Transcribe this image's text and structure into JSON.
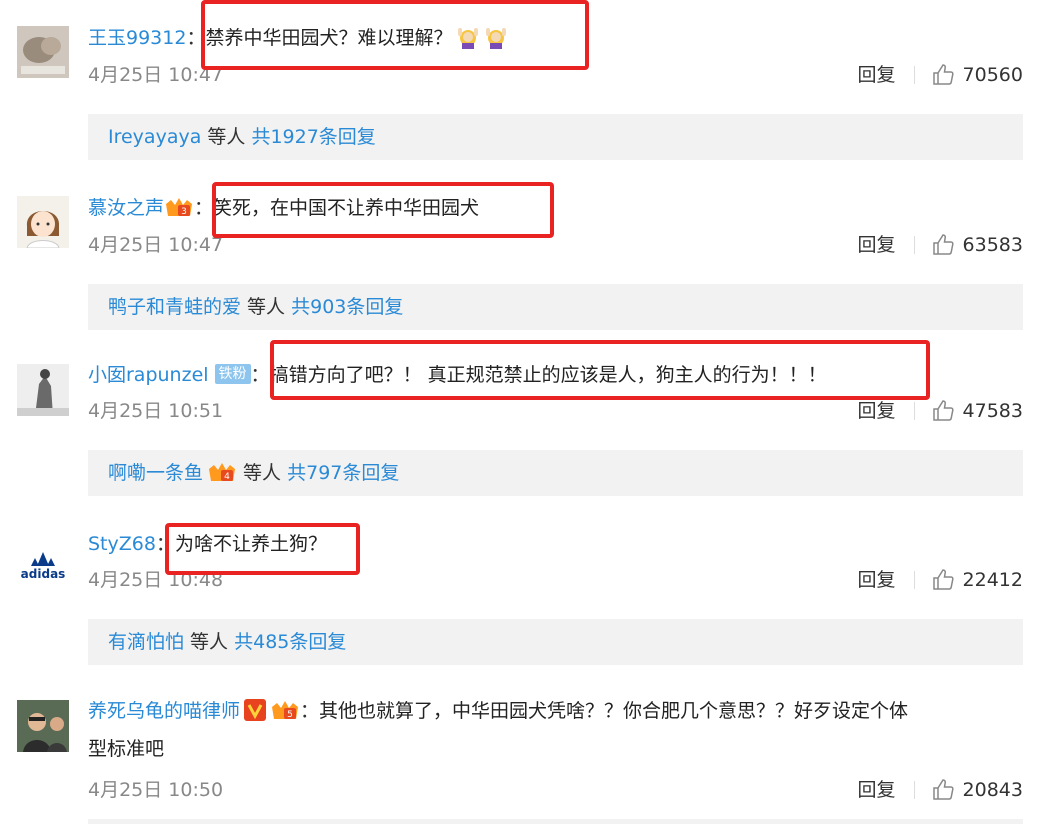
{
  "comments": [
    {
      "user": "王玉99312",
      "colon": "：",
      "text": "禁养中华田园犬？难以理解？",
      "time": "4月25日 10:47",
      "reply": "回复",
      "likes": "70560",
      "sub": {
        "names": "Ireyayaya",
        "mid": " 等人 ",
        "total": "共1927条回复"
      }
    },
    {
      "user": "慕汝之声",
      "colon": "：",
      "text": "笑死，在中国不让养中华田园犬",
      "time": "4月25日 10:47",
      "reply": "回复",
      "likes": "63583",
      "sub": {
        "names": "鸭子和青蛙的爱",
        "mid": " 等人 ",
        "total": "共903条回复"
      }
    },
    {
      "user": "小囡rapunzel",
      "badge": "铁粉",
      "colon": "：",
      "text": "搞错方向了吧？！ 真正规范禁止的应该是人，狗主人的行为！！！",
      "time": "4月25日 10:51",
      "reply": "回复",
      "likes": "47583",
      "sub": {
        "names": "啊嘞一条鱼",
        "mid": " 等人 ",
        "total": "共797条回复"
      }
    },
    {
      "user": "StyZ68",
      "colon": "：",
      "text": "为啥不让养土狗？",
      "time": "4月25日 10:48",
      "reply": "回复",
      "likes": "22412",
      "sub": {
        "names": "有滴怕怕",
        "mid": " 等人 ",
        "total": "共485条回复"
      }
    },
    {
      "user": "养死乌龟的喵律师",
      "colon": "：",
      "text": "其他也就算了，中华田园犬凭啥？？你合肥几个意思？？好歹设定个体",
      "text2": "型标准吧",
      "time": "4月25日 10:50",
      "reply": "回复",
      "likes": "20843"
    }
  ],
  "avatars": {
    "c1": "photo-avatar",
    "c2": "cartoon-girl-avatar",
    "c3": "grayscale-photo-avatar",
    "c4": "adidas-logo-avatar",
    "c5": "people-photo-avatar"
  },
  "icons": {
    "like": "thumbs-up-icon",
    "fan_badge": "fan-crown-badge",
    "verified": "verified-v-badge"
  },
  "colors": {
    "link": "#2a8ad6",
    "highlight": "#e92222",
    "sub_bg": "#f2f2f2"
  }
}
